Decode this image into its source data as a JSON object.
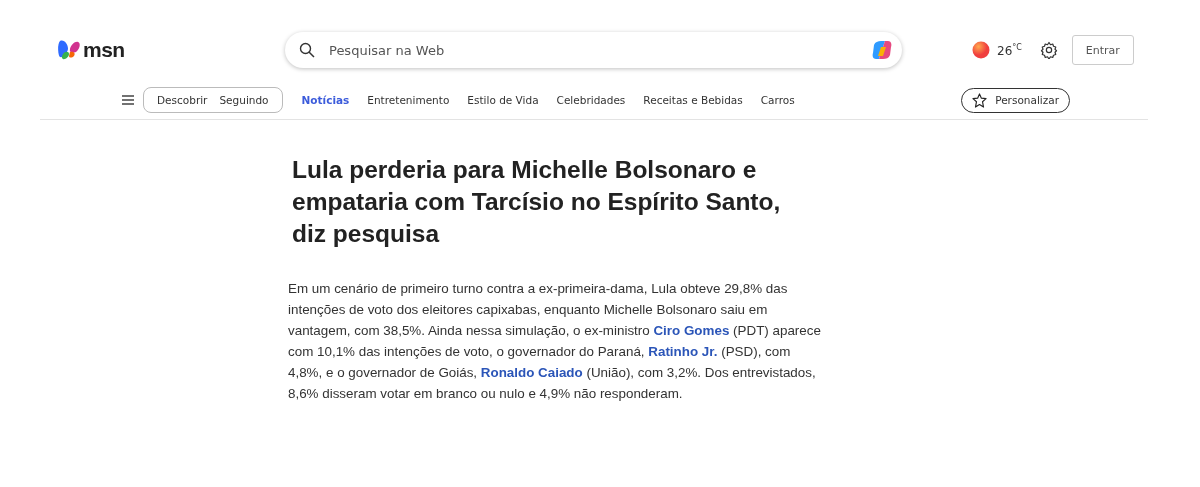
{
  "header": {
    "logo_text": "msn",
    "search": {
      "placeholder": "Pesquisar na Web"
    },
    "weather": {
      "temperature": "26",
      "unit": "°C"
    },
    "sign_in": "Entrar"
  },
  "nav": {
    "segments": [
      {
        "label": "Descobrir",
        "selected": false
      },
      {
        "label": "Seguindo",
        "selected": false
      }
    ],
    "tabs": [
      {
        "label": "Notícias",
        "selected": true
      },
      {
        "label": "Entretenimento",
        "selected": false
      },
      {
        "label": "Estilo de Vida",
        "selected": false
      },
      {
        "label": "Celebridades",
        "selected": false
      },
      {
        "label": "Receitas e Bebidas",
        "selected": false
      },
      {
        "label": "Carros",
        "selected": false
      }
    ],
    "personalize": "Personalizar"
  },
  "article": {
    "title": "Lula perderia para Michelle Bolsonaro e empataria com Tarcísio no Espírito Santo, diz pesquisa",
    "paragraph": [
      {
        "kind": "text",
        "text": "Em um cenário de primeiro turno contra a ex-primeira-dama, Lula obteve 29,8% das intenções de voto dos eleitores capixabas, enquanto Michelle Bolsonaro saiu em vantagem, com 38,5%. Ainda nessa simulação, o ex-ministro "
      },
      {
        "kind": "link",
        "text": "Ciro Gomes"
      },
      {
        "kind": "text",
        "text": " (PDT) aparece com 10,1% das intenções de voto, o governador do Paraná, "
      },
      {
        "kind": "link",
        "text": "Ratinho Jr."
      },
      {
        "kind": "text",
        "text": " (PSD), com 4,8%, e o governador de Goiás, "
      },
      {
        "kind": "link",
        "text": "Ronaldo Caiado"
      },
      {
        "kind": "text",
        "text": " (União), com 3,2%. Dos entrevistados, 8,6% disseram votar em branco ou nulo e 4,9% não responderam."
      }
    ]
  }
}
